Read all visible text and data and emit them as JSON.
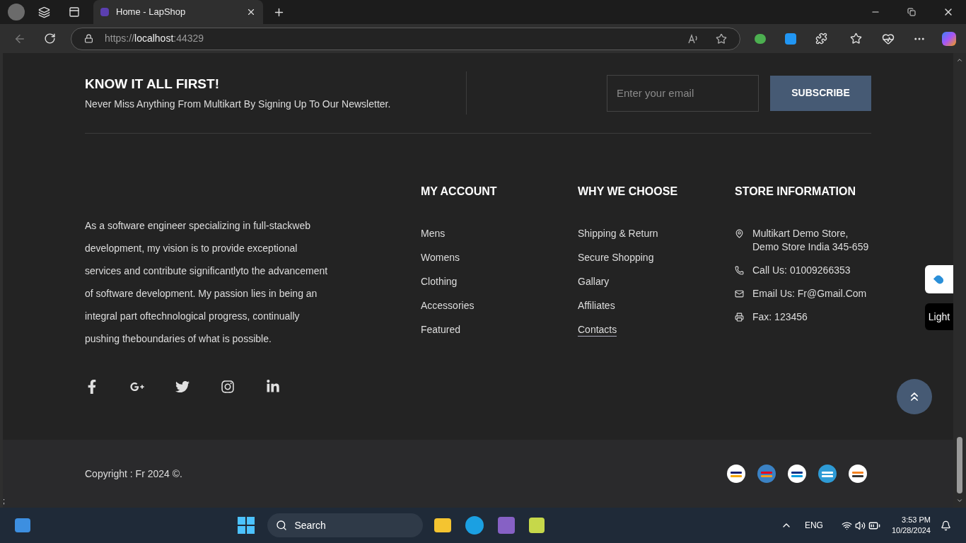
{
  "browser": {
    "tab_title": "Home - LapShop",
    "url_scheme": "https://",
    "url_host": "localhost",
    "url_port": ":44329"
  },
  "newsletter": {
    "title": "KNOW IT ALL FIRST!",
    "subtitle": "Never Miss Anything From Multikart By Signing Up To Our Newsletter.",
    "placeholder": "Enter your email",
    "button": "SUBSCRIBE"
  },
  "about": "As a software engineer specializing in full-stackweb development, my vision is to provide exceptional services and contribute significantlyto the advancement of software development. My passion lies in being an integral part oftechnological progress, continually pushing theboundaries of what is possible.",
  "socials": [
    {
      "kind": "facebook"
    },
    {
      "kind": "google-plus"
    },
    {
      "kind": "twitter"
    },
    {
      "kind": "instagram"
    },
    {
      "kind": "linkedin"
    }
  ],
  "columns": [
    {
      "title": "MY ACCOUNT",
      "links": [
        {
          "label": "Mens",
          "selected": false
        },
        {
          "label": "Womens",
          "selected": false
        },
        {
          "label": "Clothing",
          "selected": false
        },
        {
          "label": "Accessories",
          "selected": false
        },
        {
          "label": "Featured",
          "selected": false
        }
      ]
    },
    {
      "title": "WHY WE CHOOSE",
      "links": [
        {
          "label": "Shipping & Return",
          "selected": false
        },
        {
          "label": "Secure Shopping",
          "selected": false
        },
        {
          "label": "Gallary",
          "selected": false
        },
        {
          "label": "Affiliates",
          "selected": false
        },
        {
          "label": "Contacts",
          "selected": true
        }
      ]
    }
  ],
  "store": {
    "title": "STORE INFORMATION",
    "items": [
      {
        "kind": "address",
        "lines": [
          "Multikart Demo Store,",
          "Demo Store India 345-659"
        ]
      },
      {
        "kind": "phone",
        "lines": [
          "Call Us: 01009266353"
        ]
      },
      {
        "kind": "email",
        "lines": [
          "Email Us: Fr@Gmail.Com"
        ]
      },
      {
        "kind": "fax",
        "lines": [
          "Fax: 123456"
        ]
      }
    ]
  },
  "theme_button": "Light",
  "copyright": "Copyright : Fr 2024 ©.",
  "payments": [
    {
      "kind": "visa"
    },
    {
      "kind": "mastercard"
    },
    {
      "kind": "paypal"
    },
    {
      "kind": "amex"
    },
    {
      "kind": "discover"
    }
  ],
  "stray_text": ";",
  "taskbar": {
    "search": "Search",
    "language": "ENG",
    "time": "3:53 PM",
    "date": "10/28/2024"
  }
}
